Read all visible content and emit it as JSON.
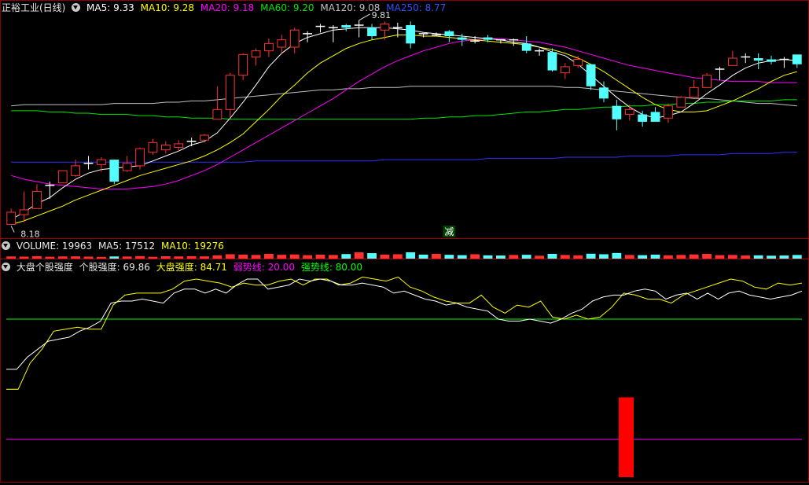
{
  "header": {
    "stock_name": "正裕工业(日线)",
    "ma5": "MA5: 9.33",
    "ma10": "MA10: 9.28",
    "ma20": "MA20: 9.18",
    "ma60": "MA60: 9.20",
    "ma120": "MA120: 9.08",
    "ma250": "MA250: 8.77"
  },
  "volume_header": {
    "volume": "VOLUME: 19963",
    "ma5": "MA5: 17512",
    "ma10": "MA10: 19276"
  },
  "indicator_header": {
    "name": "大盘个股强度",
    "stock_strength": "个股强度: 69.86",
    "market_strength": "大盘强度: 84.71",
    "weak_line": "弱势线: 20.00",
    "strong_line": "强势线: 80.00"
  },
  "annotations": {
    "high_label": "9.81",
    "low_label": "8.18",
    "signal_label": "减"
  },
  "colors": {
    "up": "#ff3232",
    "down": "#54ffff",
    "doji": "#ffffff",
    "ma5": "#ffffff",
    "ma10": "#ffff00",
    "ma20": "#ff00ff",
    "ma60": "#00e600",
    "ma120": "#c0c0c0",
    "ma250": "#3030ff",
    "weak_line": "#ff00ff",
    "strong_line": "#00ff00",
    "stock_strength": "#ffffff",
    "market_strength": "#ffff00",
    "signal_bar": "#ff0000"
  },
  "chart_data": [
    {
      "type": "candlestick",
      "ylim": [
        8.1,
        9.9
      ],
      "candles": [
        {
          "o": 8.18,
          "h": 8.31,
          "l": 8.18,
          "c": 8.28
        },
        {
          "o": 8.26,
          "h": 8.45,
          "l": 8.2,
          "c": 8.3
        },
        {
          "o": 8.31,
          "h": 8.51,
          "l": 8.31,
          "c": 8.45
        },
        {
          "o": 8.5,
          "h": 8.53,
          "l": 8.39,
          "c": 8.5
        },
        {
          "o": 8.52,
          "h": 8.62,
          "l": 8.52,
          "c": 8.62
        },
        {
          "o": 8.58,
          "h": 8.71,
          "l": 8.57,
          "c": 8.66
        },
        {
          "o": 8.67,
          "h": 8.74,
          "l": 8.63,
          "c": 8.68
        },
        {
          "o": 8.67,
          "h": 8.73,
          "l": 8.61,
          "c": 8.71
        },
        {
          "o": 8.71,
          "h": 8.71,
          "l": 8.51,
          "c": 8.53
        },
        {
          "o": 8.62,
          "h": 8.74,
          "l": 8.61,
          "c": 8.68
        },
        {
          "o": 8.66,
          "h": 8.81,
          "l": 8.63,
          "c": 8.8
        },
        {
          "o": 8.77,
          "h": 8.88,
          "l": 8.75,
          "c": 8.85
        },
        {
          "o": 8.79,
          "h": 8.86,
          "l": 8.76,
          "c": 8.83
        },
        {
          "o": 8.81,
          "h": 8.87,
          "l": 8.78,
          "c": 8.84
        },
        {
          "o": 8.85,
          "h": 8.89,
          "l": 8.82,
          "c": 8.86
        },
        {
          "o": 8.87,
          "h": 8.92,
          "l": 8.87,
          "c": 8.91
        },
        {
          "o": 9.04,
          "h": 9.31,
          "l": 9.04,
          "c": 9.12
        },
        {
          "o": 9.12,
          "h": 9.42,
          "l": 9.06,
          "c": 9.4
        },
        {
          "o": 9.4,
          "h": 9.58,
          "l": 9.36,
          "c": 9.57
        },
        {
          "o": 9.55,
          "h": 9.62,
          "l": 9.48,
          "c": 9.6
        },
        {
          "o": 9.6,
          "h": 9.7,
          "l": 9.55,
          "c": 9.66
        },
        {
          "o": 9.63,
          "h": 9.73,
          "l": 9.58,
          "c": 9.69
        },
        {
          "o": 9.63,
          "h": 9.79,
          "l": 9.58,
          "c": 9.77
        },
        {
          "o": 9.74,
          "h": 9.76,
          "l": 9.67,
          "c": 9.74
        },
        {
          "o": 9.79,
          "h": 9.82,
          "l": 9.75,
          "c": 9.8
        },
        {
          "o": 9.78,
          "h": 9.81,
          "l": 9.67,
          "c": 9.79
        },
        {
          "o": 9.81,
          "h": 9.82,
          "l": 9.76,
          "c": 9.79
        },
        {
          "o": 9.81,
          "h": 9.85,
          "l": 9.71,
          "c": 9.81
        },
        {
          "o": 9.79,
          "h": 9.82,
          "l": 9.69,
          "c": 9.72
        },
        {
          "o": 9.77,
          "h": 9.84,
          "l": 9.69,
          "c": 9.82
        },
        {
          "o": 9.79,
          "h": 9.83,
          "l": 9.71,
          "c": 9.79
        },
        {
          "o": 9.81,
          "h": 9.84,
          "l": 9.62,
          "c": 9.66
        },
        {
          "o": 9.74,
          "h": 9.74,
          "l": 9.71,
          "c": 9.73
        },
        {
          "o": 9.73,
          "h": 9.75,
          "l": 9.72,
          "c": 9.73
        },
        {
          "o": 9.76,
          "h": 9.77,
          "l": 9.67,
          "c": 9.72
        },
        {
          "o": 9.71,
          "h": 9.74,
          "l": 9.64,
          "c": 9.69
        },
        {
          "o": 9.68,
          "h": 9.72,
          "l": 9.66,
          "c": 9.68
        },
        {
          "o": 9.71,
          "h": 9.73,
          "l": 9.67,
          "c": 9.69
        },
        {
          "o": 9.69,
          "h": 9.69,
          "l": 9.66,
          "c": 9.68
        },
        {
          "o": 9.68,
          "h": 9.7,
          "l": 9.64,
          "c": 9.69
        },
        {
          "o": 9.66,
          "h": 9.72,
          "l": 9.58,
          "c": 9.6
        },
        {
          "o": 9.59,
          "h": 9.62,
          "l": 9.56,
          "c": 9.6
        },
        {
          "o": 9.59,
          "h": 9.62,
          "l": 9.43,
          "c": 9.44
        },
        {
          "o": 9.42,
          "h": 9.5,
          "l": 9.37,
          "c": 9.47
        },
        {
          "o": 9.48,
          "h": 9.56,
          "l": 9.46,
          "c": 9.53
        },
        {
          "o": 9.49,
          "h": 9.49,
          "l": 9.28,
          "c": 9.31
        },
        {
          "o": 9.3,
          "h": 9.35,
          "l": 9.18,
          "c": 9.21
        },
        {
          "o": 9.15,
          "h": 9.2,
          "l": 8.95,
          "c": 9.04
        },
        {
          "o": 9.08,
          "h": 9.16,
          "l": 9.03,
          "c": 9.12
        },
        {
          "o": 9.08,
          "h": 9.11,
          "l": 8.98,
          "c": 9.02
        },
        {
          "o": 9.1,
          "h": 9.14,
          "l": 9.04,
          "c": 9.02
        },
        {
          "o": 9.05,
          "h": 9.17,
          "l": 9.01,
          "c": 9.15
        },
        {
          "o": 9.14,
          "h": 9.23,
          "l": 9.14,
          "c": 9.22
        },
        {
          "o": 9.22,
          "h": 9.36,
          "l": 9.22,
          "c": 9.3
        },
        {
          "o": 9.3,
          "h": 9.42,
          "l": 9.3,
          "c": 9.4
        },
        {
          "o": 9.45,
          "h": 9.47,
          "l": 9.36,
          "c": 9.45
        },
        {
          "o": 9.48,
          "h": 9.6,
          "l": 9.48,
          "c": 9.54
        },
        {
          "o": 9.55,
          "h": 9.58,
          "l": 9.5,
          "c": 9.55
        },
        {
          "o": 9.54,
          "h": 9.58,
          "l": 9.45,
          "c": 9.52
        },
        {
          "o": 9.53,
          "h": 9.56,
          "l": 9.49,
          "c": 9.51
        },
        {
          "o": 9.53,
          "h": 9.55,
          "l": 9.46,
          "c": 9.52
        },
        {
          "o": 9.57,
          "h": 9.57,
          "l": 9.46,
          "c": 9.49
        }
      ],
      "ma_lines": {
        "ma5": [
          8.22,
          8.28,
          8.35,
          8.4,
          8.48,
          8.55,
          8.6,
          8.63,
          8.64,
          8.65,
          8.66,
          8.7,
          8.74,
          8.78,
          8.83,
          8.86,
          8.93,
          9.05,
          9.18,
          9.32,
          9.47,
          9.58,
          9.66,
          9.71,
          9.74,
          9.77,
          9.78,
          9.79,
          9.79,
          9.79,
          9.78,
          9.77,
          9.75,
          9.74,
          9.73,
          9.72,
          9.71,
          9.7,
          9.69,
          9.67,
          9.66,
          9.63,
          9.59,
          9.56,
          9.49,
          9.4,
          9.31,
          9.22,
          9.14,
          9.08,
          9.05,
          9.07,
          9.1,
          9.17,
          9.25,
          9.32,
          9.4,
          9.46,
          9.5,
          9.52,
          9.53,
          9.52
        ],
        "ma10": [
          8.18,
          8.21,
          8.25,
          8.29,
          8.33,
          8.38,
          8.42,
          8.46,
          8.5,
          8.54,
          8.58,
          8.61,
          8.64,
          8.67,
          8.7,
          8.74,
          8.79,
          8.85,
          8.92,
          9.02,
          9.12,
          9.23,
          9.32,
          9.42,
          9.5,
          9.56,
          9.62,
          9.66,
          9.69,
          9.71,
          9.73,
          9.73,
          9.72,
          9.72,
          9.71,
          9.7,
          9.69,
          9.68,
          9.67,
          9.66,
          9.65,
          9.63,
          9.61,
          9.58,
          9.54,
          9.49,
          9.43,
          9.36,
          9.29,
          9.22,
          9.16,
          9.12,
          9.1,
          9.1,
          9.11,
          9.15,
          9.19,
          9.24,
          9.29,
          9.35,
          9.4,
          9.43
        ],
        "ma20": [
          8.58,
          8.55,
          8.53,
          8.51,
          8.5,
          8.49,
          8.48,
          8.47,
          8.47,
          8.47,
          8.48,
          8.49,
          8.51,
          8.54,
          8.58,
          8.62,
          8.67,
          8.73,
          8.79,
          8.85,
          8.91,
          8.97,
          9.03,
          9.09,
          9.15,
          9.21,
          9.28,
          9.35,
          9.41,
          9.47,
          9.52,
          9.56,
          9.6,
          9.63,
          9.66,
          9.68,
          9.69,
          9.7,
          9.7,
          9.69,
          9.68,
          9.67,
          9.65,
          9.63,
          9.6,
          9.57,
          9.54,
          9.51,
          9.48,
          9.46,
          9.44,
          9.42,
          9.4,
          9.38,
          9.37,
          9.36,
          9.35,
          9.35,
          9.35,
          9.34,
          9.34,
          9.34
        ],
        "ma60": [
          9.11,
          9.11,
          9.11,
          9.1,
          9.1,
          9.09,
          9.09,
          9.08,
          9.08,
          9.08,
          9.07,
          9.07,
          9.06,
          9.06,
          9.05,
          9.05,
          9.05,
          9.04,
          9.04,
          9.04,
          9.04,
          9.04,
          9.04,
          9.04,
          9.04,
          9.04,
          9.04,
          9.04,
          9.04,
          9.04,
          9.04,
          9.04,
          9.05,
          9.05,
          9.06,
          9.06,
          9.07,
          9.07,
          9.08,
          9.09,
          9.1,
          9.1,
          9.11,
          9.12,
          9.12,
          9.13,
          9.14,
          9.14,
          9.15,
          9.15,
          9.16,
          9.16,
          9.17,
          9.17,
          9.18,
          9.18,
          9.19,
          9.19,
          9.19,
          9.19,
          9.2,
          9.2
        ],
        "ma120": [
          9.15,
          9.16,
          9.16,
          9.16,
          9.16,
          9.16,
          9.16,
          9.16,
          9.17,
          9.17,
          9.17,
          9.17,
          9.18,
          9.18,
          9.19,
          9.19,
          9.2,
          9.21,
          9.22,
          9.23,
          9.24,
          9.25,
          9.26,
          9.27,
          9.28,
          9.28,
          9.29,
          9.29,
          9.3,
          9.3,
          9.3,
          9.31,
          9.31,
          9.31,
          9.31,
          9.31,
          9.31,
          9.31,
          9.31,
          9.31,
          9.31,
          9.31,
          9.31,
          9.3,
          9.3,
          9.29,
          9.28,
          9.27,
          9.26,
          9.25,
          9.24,
          9.23,
          9.22,
          9.21,
          9.21,
          9.2,
          9.19,
          9.18,
          9.17,
          9.17,
          9.16,
          9.15
        ],
        "ma250": [
          8.69,
          8.69,
          8.69,
          8.69,
          8.69,
          8.69,
          8.69,
          8.69,
          8.69,
          8.69,
          8.69,
          8.69,
          8.69,
          8.69,
          8.69,
          8.69,
          8.69,
          8.69,
          8.69,
          8.7,
          8.7,
          8.7,
          8.7,
          8.7,
          8.7,
          8.7,
          8.7,
          8.7,
          8.7,
          8.71,
          8.71,
          8.71,
          8.71,
          8.71,
          8.71,
          8.71,
          8.71,
          8.72,
          8.72,
          8.72,
          8.72,
          8.72,
          8.72,
          8.73,
          8.73,
          8.73,
          8.73,
          8.73,
          8.74,
          8.74,
          8.74,
          8.74,
          8.75,
          8.75,
          8.75,
          8.75,
          8.76,
          8.76,
          8.76,
          8.76,
          8.77,
          8.77
        ]
      }
    },
    {
      "type": "bar",
      "ylabel": "VOLUME",
      "ylim": [
        0,
        260000
      ],
      "values": [
        12000,
        11000,
        13500,
        10500,
        12000,
        12500,
        11000,
        9500,
        12000,
        11500,
        14000,
        10000,
        13000,
        12000,
        13500,
        12500,
        18000,
        24000,
        22000,
        20000,
        26000,
        21000,
        23000,
        19000,
        22000,
        20000,
        25000,
        38000,
        30000,
        22000,
        24000,
        36000,
        22000,
        26000,
        21000,
        19000,
        24000,
        18000,
        17000,
        20000,
        21000,
        16000,
        26000,
        20000,
        18000,
        27000,
        24000,
        31000,
        20000,
        19000,
        22000,
        18000,
        20000,
        23000,
        26000,
        19000,
        20000,
        17000,
        18000,
        16000,
        17000,
        19963
      ]
    },
    {
      "type": "line",
      "ylim": [
        0,
        100
      ],
      "series": [
        {
          "name": "个股强度",
          "values": [
            55,
            55,
            61,
            65,
            69,
            70,
            71,
            74,
            76,
            79,
            88,
            89,
            89,
            90,
            89,
            88,
            93,
            95,
            95,
            93,
            95,
            93,
            97,
            100,
            100,
            95,
            96,
            97,
            100,
            99,
            100,
            99,
            97,
            97,
            98,
            97,
            96,
            93,
            94,
            92,
            90,
            89,
            87,
            88,
            86,
            85,
            84,
            80,
            79,
            79,
            80,
            79,
            78,
            80,
            83,
            85,
            89,
            91,
            92,
            92,
            94,
            95,
            94,
            90,
            92,
            93,
            90,
            93,
            90,
            93,
            94,
            92,
            91,
            90,
            91,
            92,
            94
          ]
        },
        {
          "name": "大盘强度",
          "values": [
            45,
            45,
            58,
            65,
            74,
            75,
            76,
            75,
            75,
            87,
            92,
            93,
            93,
            93,
            95,
            99,
            100,
            99,
            98,
            96,
            98,
            97,
            97,
            99,
            100,
            97,
            100,
            100,
            97,
            98,
            101,
            100,
            99,
            101,
            96,
            94,
            91,
            89,
            88,
            88,
            92,
            86,
            83,
            87,
            86,
            89,
            81,
            80,
            82,
            80,
            81,
            86,
            93,
            92,
            90,
            90,
            88,
            92,
            94,
            96,
            98,
            100,
            99,
            96,
            95,
            98,
            97,
            98
          ]
        }
      ],
      "hlines": {
        "弱势线": 20.0,
        "强势线": 80.0
      }
    }
  ]
}
